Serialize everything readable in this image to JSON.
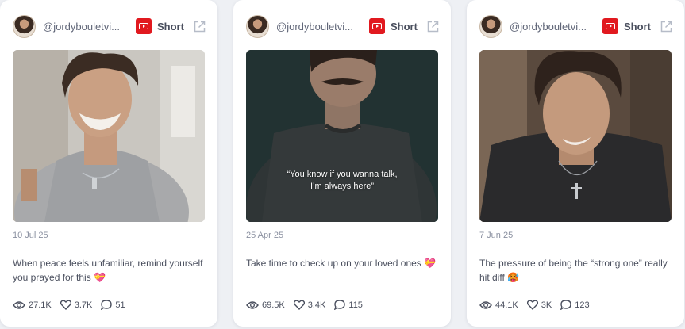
{
  "cards": [
    {
      "handle": "@jordybouletvi...",
      "type_label": "Short",
      "date": "10 Jul 25",
      "caption": "",
      "description": "When peace feels unfamiliar, remind yourself you prayed for this 💝",
      "views": "27.1K",
      "likes": "3.7K",
      "comments": "51"
    },
    {
      "handle": "@jordybouletvi...",
      "type_label": "Short",
      "date": "25 Apr 25",
      "caption_line1": "“You know if you wanna talk,",
      "caption_line2": "I’m always here”",
      "description": "Take time to check up on your loved ones 💝",
      "views": "69.5K",
      "likes": "3.4K",
      "comments": "115"
    },
    {
      "handle": "@jordybouletvi...",
      "type_label": "Short",
      "date": "7 Jun 25",
      "caption": "",
      "description": "The pressure of being the “strong one” really hit diff 🥵",
      "views": "44.1K",
      "likes": "3K",
      "comments": "123"
    }
  ],
  "icons": {
    "platform": "youtube-icon",
    "external": "external-link-icon",
    "views": "eye-icon",
    "likes": "heart-icon",
    "comments": "comment-icon"
  },
  "colors": {
    "youtube_red": "#e1191f",
    "card_bg": "#ffffff",
    "page_bg": "#eef0f4",
    "muted_text": "#8a90a0"
  }
}
